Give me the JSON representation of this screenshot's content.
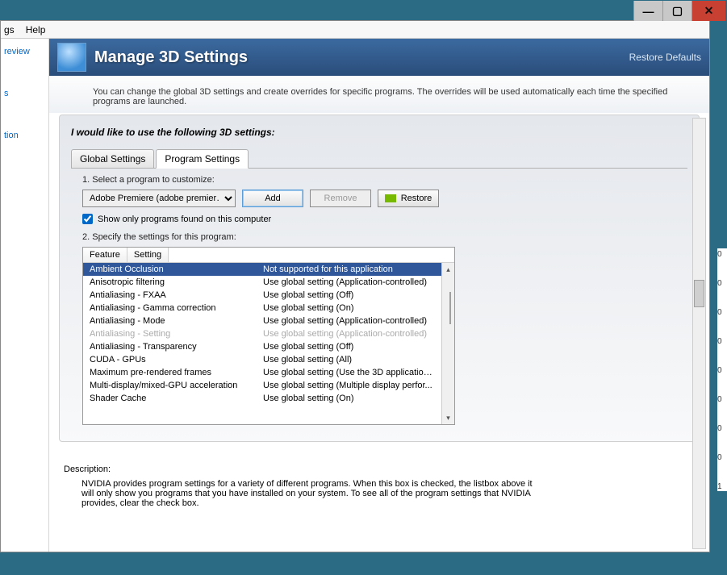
{
  "titlebar": {},
  "menubar": {
    "item1": "gs",
    "item2": "Help"
  },
  "sidebar": {
    "link1": "review",
    "link2": "s",
    "link3": "tion"
  },
  "header": {
    "title": "Manage 3D Settings",
    "restore": "Restore Defaults"
  },
  "intro": "You can change the global 3D settings and create overrides for specific programs. The overrides will be used automatically each time the specified programs are launched.",
  "panel_lead": "I would like to use the following 3D settings:",
  "tabs": {
    "global": "Global Settings",
    "program": "Program Settings"
  },
  "step1": "1. Select a program to customize:",
  "program_select": "Adobe Premiere (adobe premier…",
  "btn_add": "Add",
  "btn_remove": "Remove",
  "btn_restore": "Restore",
  "chk_label": "Show only programs found on this computer",
  "step2": "2. Specify the settings for this program:",
  "grid_headers": {
    "feature": "Feature",
    "setting": "Setting"
  },
  "grid_rows": [
    {
      "feature": "Ambient Occlusion",
      "setting": "Not supported for this application",
      "selected": true
    },
    {
      "feature": "Anisotropic filtering",
      "setting": "Use global setting (Application-controlled)"
    },
    {
      "feature": "Antialiasing - FXAA",
      "setting": "Use global setting (Off)"
    },
    {
      "feature": "Antialiasing - Gamma correction",
      "setting": "Use global setting (On)"
    },
    {
      "feature": "Antialiasing - Mode",
      "setting": "Use global setting (Application-controlled)"
    },
    {
      "feature": "Antialiasing - Setting",
      "setting": "Use global setting (Application-controlled)",
      "grey": true
    },
    {
      "feature": "Antialiasing - Transparency",
      "setting": "Use global setting (Off)"
    },
    {
      "feature": "CUDA - GPUs",
      "setting": "Use global setting (All)"
    },
    {
      "feature": "Maximum pre-rendered frames",
      "setting": "Use global setting (Use the 3D application ..."
    },
    {
      "feature": "Multi-display/mixed-GPU acceleration",
      "setting": "Use global setting (Multiple display perfor..."
    },
    {
      "feature": "Shader Cache",
      "setting": "Use global setting (On)"
    }
  ],
  "description": {
    "title": "Description:",
    "body": "NVIDIA provides program settings for a variety of different programs. When this box is checked, the listbox above it will only show you programs that you have installed on your system. To see all of the program settings that NVIDIA provides, clear the check box."
  },
  "numstrip": [
    "0",
    "0",
    "0",
    "0",
    "0",
    "0",
    "0",
    "0",
    "1"
  ]
}
